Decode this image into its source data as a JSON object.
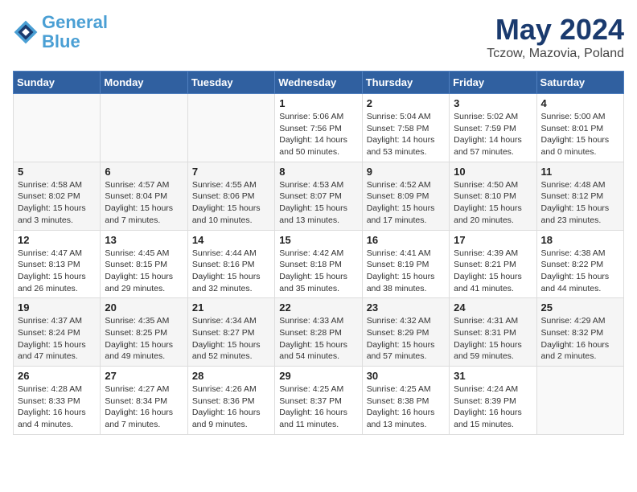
{
  "header": {
    "logo_line1": "General",
    "logo_line2": "Blue",
    "title": "May 2024",
    "subtitle": "Tczow, Mazovia, Poland"
  },
  "days_of_week": [
    "Sunday",
    "Monday",
    "Tuesday",
    "Wednesday",
    "Thursday",
    "Friday",
    "Saturday"
  ],
  "weeks": [
    [
      {
        "day": "",
        "info": ""
      },
      {
        "day": "",
        "info": ""
      },
      {
        "day": "",
        "info": ""
      },
      {
        "day": "1",
        "info": "Sunrise: 5:06 AM\nSunset: 7:56 PM\nDaylight: 14 hours\nand 50 minutes."
      },
      {
        "day": "2",
        "info": "Sunrise: 5:04 AM\nSunset: 7:58 PM\nDaylight: 14 hours\nand 53 minutes."
      },
      {
        "day": "3",
        "info": "Sunrise: 5:02 AM\nSunset: 7:59 PM\nDaylight: 14 hours\nand 57 minutes."
      },
      {
        "day": "4",
        "info": "Sunrise: 5:00 AM\nSunset: 8:01 PM\nDaylight: 15 hours\nand 0 minutes."
      }
    ],
    [
      {
        "day": "5",
        "info": "Sunrise: 4:58 AM\nSunset: 8:02 PM\nDaylight: 15 hours\nand 3 minutes."
      },
      {
        "day": "6",
        "info": "Sunrise: 4:57 AM\nSunset: 8:04 PM\nDaylight: 15 hours\nand 7 minutes."
      },
      {
        "day": "7",
        "info": "Sunrise: 4:55 AM\nSunset: 8:06 PM\nDaylight: 15 hours\nand 10 minutes."
      },
      {
        "day": "8",
        "info": "Sunrise: 4:53 AM\nSunset: 8:07 PM\nDaylight: 15 hours\nand 13 minutes."
      },
      {
        "day": "9",
        "info": "Sunrise: 4:52 AM\nSunset: 8:09 PM\nDaylight: 15 hours\nand 17 minutes."
      },
      {
        "day": "10",
        "info": "Sunrise: 4:50 AM\nSunset: 8:10 PM\nDaylight: 15 hours\nand 20 minutes."
      },
      {
        "day": "11",
        "info": "Sunrise: 4:48 AM\nSunset: 8:12 PM\nDaylight: 15 hours\nand 23 minutes."
      }
    ],
    [
      {
        "day": "12",
        "info": "Sunrise: 4:47 AM\nSunset: 8:13 PM\nDaylight: 15 hours\nand 26 minutes."
      },
      {
        "day": "13",
        "info": "Sunrise: 4:45 AM\nSunset: 8:15 PM\nDaylight: 15 hours\nand 29 minutes."
      },
      {
        "day": "14",
        "info": "Sunrise: 4:44 AM\nSunset: 8:16 PM\nDaylight: 15 hours\nand 32 minutes."
      },
      {
        "day": "15",
        "info": "Sunrise: 4:42 AM\nSunset: 8:18 PM\nDaylight: 15 hours\nand 35 minutes."
      },
      {
        "day": "16",
        "info": "Sunrise: 4:41 AM\nSunset: 8:19 PM\nDaylight: 15 hours\nand 38 minutes."
      },
      {
        "day": "17",
        "info": "Sunrise: 4:39 AM\nSunset: 8:21 PM\nDaylight: 15 hours\nand 41 minutes."
      },
      {
        "day": "18",
        "info": "Sunrise: 4:38 AM\nSunset: 8:22 PM\nDaylight: 15 hours\nand 44 minutes."
      }
    ],
    [
      {
        "day": "19",
        "info": "Sunrise: 4:37 AM\nSunset: 8:24 PM\nDaylight: 15 hours\nand 47 minutes."
      },
      {
        "day": "20",
        "info": "Sunrise: 4:35 AM\nSunset: 8:25 PM\nDaylight: 15 hours\nand 49 minutes."
      },
      {
        "day": "21",
        "info": "Sunrise: 4:34 AM\nSunset: 8:27 PM\nDaylight: 15 hours\nand 52 minutes."
      },
      {
        "day": "22",
        "info": "Sunrise: 4:33 AM\nSunset: 8:28 PM\nDaylight: 15 hours\nand 54 minutes."
      },
      {
        "day": "23",
        "info": "Sunrise: 4:32 AM\nSunset: 8:29 PM\nDaylight: 15 hours\nand 57 minutes."
      },
      {
        "day": "24",
        "info": "Sunrise: 4:31 AM\nSunset: 8:31 PM\nDaylight: 15 hours\nand 59 minutes."
      },
      {
        "day": "25",
        "info": "Sunrise: 4:29 AM\nSunset: 8:32 PM\nDaylight: 16 hours\nand 2 minutes."
      }
    ],
    [
      {
        "day": "26",
        "info": "Sunrise: 4:28 AM\nSunset: 8:33 PM\nDaylight: 16 hours\nand 4 minutes."
      },
      {
        "day": "27",
        "info": "Sunrise: 4:27 AM\nSunset: 8:34 PM\nDaylight: 16 hours\nand 7 minutes."
      },
      {
        "day": "28",
        "info": "Sunrise: 4:26 AM\nSunset: 8:36 PM\nDaylight: 16 hours\nand 9 minutes."
      },
      {
        "day": "29",
        "info": "Sunrise: 4:25 AM\nSunset: 8:37 PM\nDaylight: 16 hours\nand 11 minutes."
      },
      {
        "day": "30",
        "info": "Sunrise: 4:25 AM\nSunset: 8:38 PM\nDaylight: 16 hours\nand 13 minutes."
      },
      {
        "day": "31",
        "info": "Sunrise: 4:24 AM\nSunset: 8:39 PM\nDaylight: 16 hours\nand 15 minutes."
      },
      {
        "day": "",
        "info": ""
      }
    ]
  ]
}
